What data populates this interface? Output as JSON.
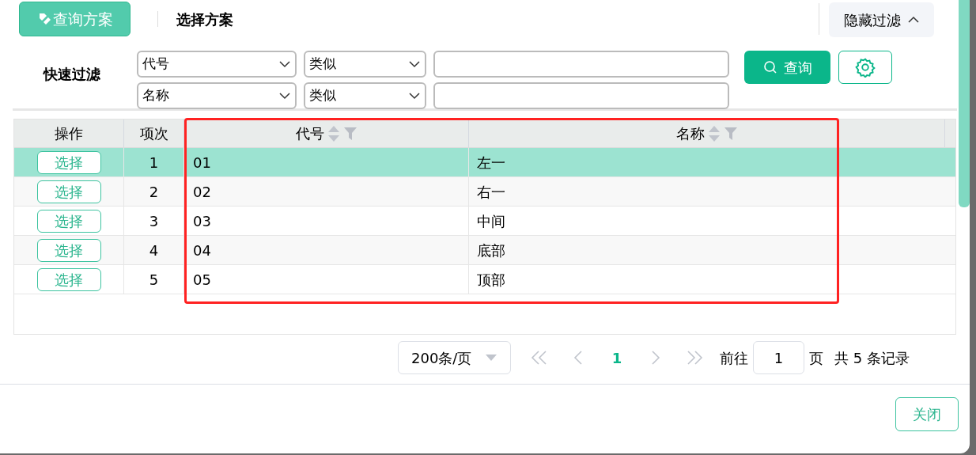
{
  "toolbar": {
    "scheme_button": "查询方案",
    "title": "选择方案",
    "toggle_filter": "隐藏过滤"
  },
  "quick_filter": {
    "label": "快速过滤",
    "rows": [
      {
        "field": "代号",
        "operator": "类似"
      },
      {
        "field": "名称",
        "operator": "类似"
      }
    ],
    "query_button": "查询"
  },
  "table": {
    "columns": [
      {
        "label": "操作",
        "sortable": false
      },
      {
        "label": "项次",
        "sortable": false
      },
      {
        "label": "代号",
        "sortable": true
      },
      {
        "label": "名称",
        "sortable": true
      }
    ],
    "rows": [
      {
        "action": "选择",
        "index": "1",
        "code": "01",
        "name": "左一",
        "selected": true
      },
      {
        "action": "选择",
        "index": "2",
        "code": "02",
        "name": "右一",
        "selected": false
      },
      {
        "action": "选择",
        "index": "3",
        "code": "03",
        "name": "中间",
        "selected": false
      },
      {
        "action": "选择",
        "index": "4",
        "code": "04",
        "name": "底部",
        "selected": false
      },
      {
        "action": "选择",
        "index": "5",
        "code": "05",
        "name": "顶部",
        "selected": false
      }
    ]
  },
  "pagination": {
    "page_size": "200条/页",
    "pages": [
      {
        "label": "1",
        "selected": true
      }
    ],
    "goto_label": "前往",
    "goto_value": "1",
    "page_unit": "页",
    "total": "共 5 条记录"
  },
  "footer": {
    "close_button": "关闭"
  }
}
